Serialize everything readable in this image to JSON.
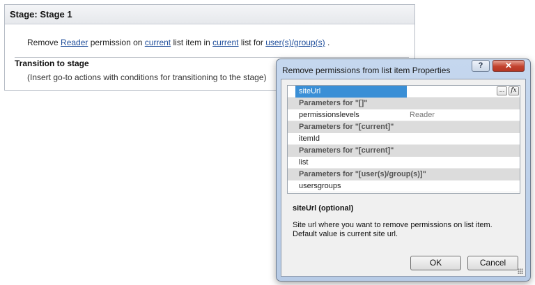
{
  "stage": {
    "title": "Stage: Stage 1",
    "sentence": {
      "part1": "Remove",
      "link_permission": "Reader",
      "part2": "permission on",
      "link_item": "current",
      "part3": "list item in",
      "link_list": "current",
      "part4": "list for",
      "link_users": "user(s)/group(s)",
      "part5": "."
    },
    "transition_title": "Transition to stage",
    "transition_hint": "(Insert go-to actions with conditions for transitioning to the stage)"
  },
  "dialog": {
    "title": "Remove permissions from list item Properties",
    "help_label": "?",
    "close_label": "✕",
    "grid": {
      "selected_key": "siteUrl",
      "ellipsis_label": "...",
      "fx_label": "fx",
      "rows": [
        {
          "type": "prop",
          "key": "siteUrl",
          "value": "",
          "selected": true
        },
        {
          "type": "cat",
          "label": "Parameters for \"[]\""
        },
        {
          "type": "prop",
          "key": "permissionslevels",
          "value": "Reader"
        },
        {
          "type": "cat",
          "label": "Parameters for \"[current]\""
        },
        {
          "type": "prop",
          "key": "itemId",
          "value": ""
        },
        {
          "type": "cat",
          "label": "Parameters for \"[current]\""
        },
        {
          "type": "prop",
          "key": "list",
          "value": ""
        },
        {
          "type": "cat",
          "label": "Parameters for \"[user(s)/group(s)]\""
        },
        {
          "type": "prop",
          "key": "usersgroups",
          "value": ""
        }
      ]
    },
    "description_title": "siteUrl (optional)",
    "description_text": "Site url where you want to remove permissions on list item. Default value is current site url.",
    "ok_label": "OK",
    "cancel_label": "Cancel"
  }
}
